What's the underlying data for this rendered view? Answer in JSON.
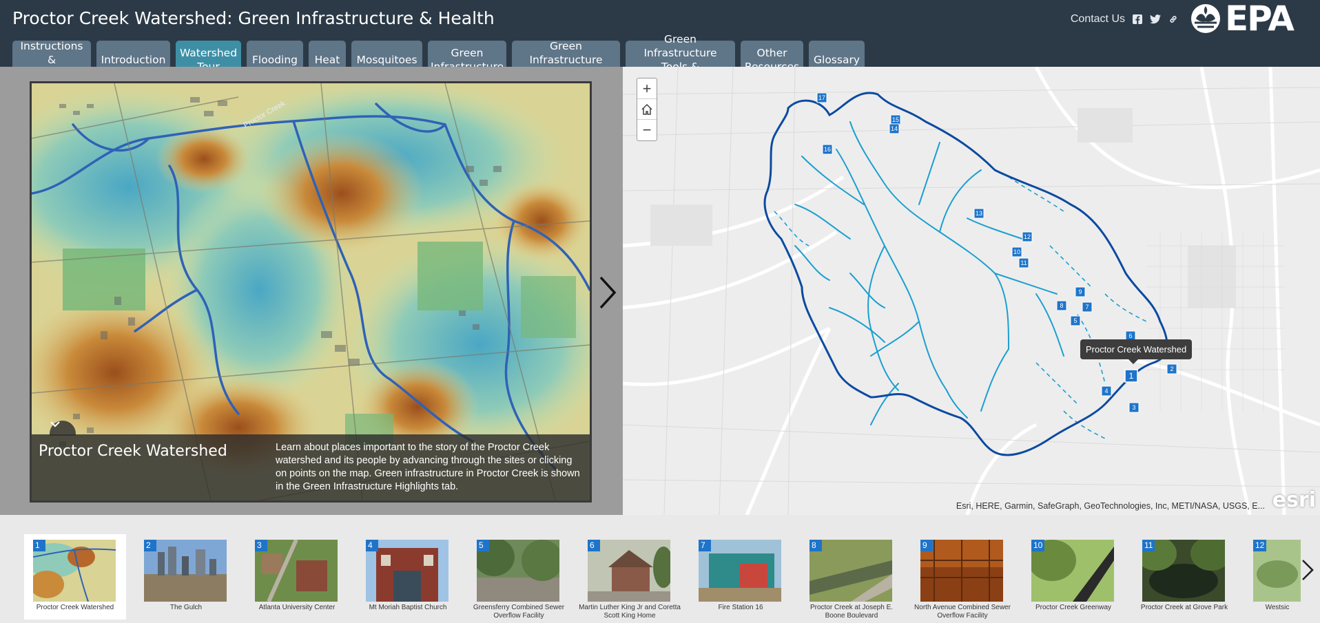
{
  "header": {
    "title": "Proctor Creek Watershed: Green Infrastructure & Health",
    "contact": "Contact Us",
    "social_icons": [
      "facebook-icon",
      "twitter-icon",
      "link-icon"
    ],
    "logo_text": "EPA"
  },
  "tabs": [
    {
      "label": "Instructions &\nContributors",
      "active": false
    },
    {
      "label": "Introduction",
      "active": false
    },
    {
      "label": "Watershed\nTour",
      "active": true
    },
    {
      "label": "Flooding",
      "active": false
    },
    {
      "label": "Heat",
      "active": false
    },
    {
      "label": "Mosquitoes",
      "active": false
    },
    {
      "label": "Green\nInfrastructure",
      "active": false
    },
    {
      "label": "Green Infrastructure\nSpotlight",
      "active": false
    },
    {
      "label": "Green Infrastructure\nTools & Resources",
      "active": false
    },
    {
      "label": "Other\nResources",
      "active": false
    },
    {
      "label": "Glossary",
      "active": false
    }
  ],
  "media": {
    "caption_title": "Proctor Creek Watershed",
    "caption_text": "Learn about places important to the story of the Proctor Creek watershed and its people by advancing through the sites or clicking on points on the map. Green infrastructure in Proctor Creek is shown in the Green Infrastructure Highlights tab.",
    "map_label": "Proctor Creek"
  },
  "map": {
    "zoom_in": "+",
    "zoom_out": "−",
    "tooltip": "Proctor Creek Watershed",
    "attribution": "Esri, HERE, Garmin, SafeGraph, GeoTechnologies, Inc, METI/NASA, USGS, E...",
    "esri_logo": "esri",
    "markers": [
      "17",
      "15",
      "14",
      "16",
      "13",
      "12",
      "10",
      "11",
      "9",
      "8",
      "7",
      "5",
      "6",
      "2",
      "1",
      "4",
      "3"
    ]
  },
  "carousel": {
    "items": [
      {
        "num": "1",
        "label": "Proctor Creek Watershed",
        "selected": true
      },
      {
        "num": "2",
        "label": "The Gulch",
        "selected": false
      },
      {
        "num": "3",
        "label": "Atlanta University Center",
        "selected": false
      },
      {
        "num": "4",
        "label": "Mt Moriah Baptist Church",
        "selected": false
      },
      {
        "num": "5",
        "label": "Greensferry Combined Sewer Overflow Facility",
        "selected": false
      },
      {
        "num": "6",
        "label": "Martin Luther King Jr and Coretta Scott King Home",
        "selected": false
      },
      {
        "num": "7",
        "label": "Fire Station 16",
        "selected": false
      },
      {
        "num": "8",
        "label": "Proctor Creek at Joseph E. Boone Boulevard",
        "selected": false
      },
      {
        "num": "9",
        "label": "North Avenue Combined Sewer Overflow Facility",
        "selected": false
      },
      {
        "num": "10",
        "label": "Proctor Creek Greenway",
        "selected": false
      },
      {
        "num": "11",
        "label": "Proctor Creek at Grove Park",
        "selected": false
      },
      {
        "num": "12",
        "label": "Westsic",
        "selected": false
      }
    ]
  },
  "colors": {
    "header_bg": "#2c3a47",
    "tab_bg": "#5f7588",
    "tab_active": "#3e8fa6",
    "watershed_outline": "#0b4aa0",
    "stream": "#1a9fd0",
    "marker": "#1f74c9"
  }
}
